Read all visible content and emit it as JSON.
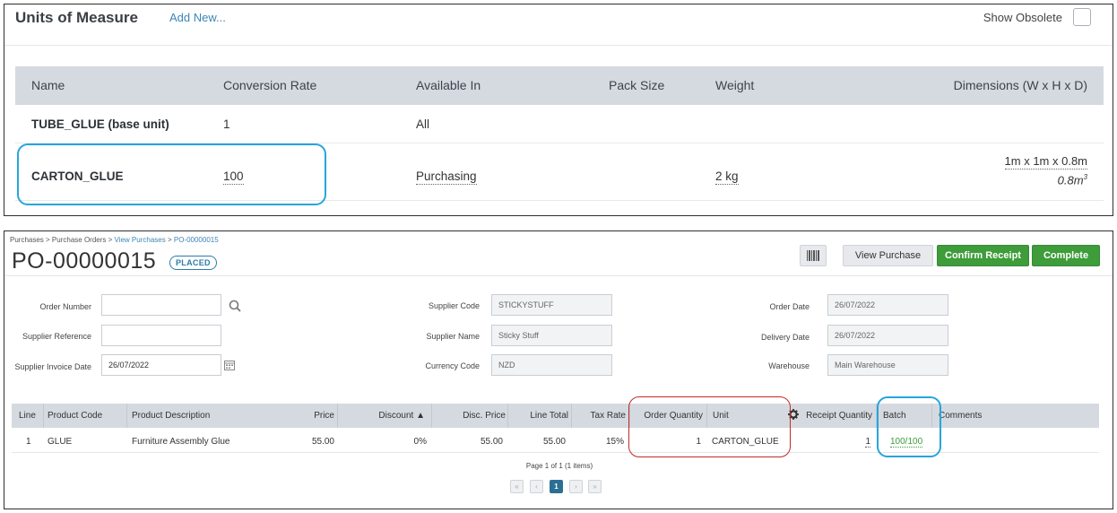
{
  "uom": {
    "title": "Units of Measure",
    "add_new": "Add New...",
    "show_obsolete": "Show Obsolete",
    "columns": [
      "Name",
      "Conversion Rate",
      "Available In",
      "Pack Size",
      "Weight",
      "Dimensions (W x H x D)"
    ],
    "rows": [
      {
        "name": "TUBE_GLUE (base unit)",
        "rate": "1",
        "available": "All",
        "pack": "",
        "weight": "",
        "dims": "",
        "volume": ""
      },
      {
        "name": "CARTON_GLUE",
        "rate": "100",
        "available": "Purchasing",
        "pack": "",
        "weight": "2 kg",
        "dims": "1m x 1m x 0.8m",
        "volume": "0.8m",
        "volume_sup": "3"
      }
    ]
  },
  "po": {
    "breadcrumb": [
      "Purchases",
      "Purchase Orders",
      "View Purchases",
      "PO-00000015"
    ],
    "breadcrumb_sep": " > ",
    "title": "PO-00000015",
    "status": "PLACED",
    "buttons": {
      "view": "View Purchase",
      "confirm": "Confirm Receipt",
      "complete": "Complete"
    },
    "fields": {
      "order_number": {
        "label": "Order Number",
        "value": ""
      },
      "supplier_reference": {
        "label": "Supplier Reference",
        "value": ""
      },
      "supplier_invoice_date": {
        "label": "Supplier Invoice Date",
        "value": "26/07/2022"
      },
      "supplier_code": {
        "label": "Supplier Code",
        "value": "STICKYSTUFF"
      },
      "supplier_name": {
        "label": "Supplier Name",
        "value": "Sticky Stuff"
      },
      "currency_code": {
        "label": "Currency Code",
        "value": "NZD"
      },
      "order_date": {
        "label": "Order Date",
        "value": "26/07/2022"
      },
      "delivery_date": {
        "label": "Delivery Date",
        "value": "26/07/2022"
      },
      "warehouse": {
        "label": "Warehouse",
        "value": "Main Warehouse"
      }
    },
    "grid": {
      "columns": [
        "Line",
        "Product Code",
        "Product Description",
        "Price",
        "Discount ▲",
        "Disc. Price",
        "Line Total",
        "Tax Rate",
        "Order Quantity",
        "Unit",
        "Receipt Quantity",
        "Batch",
        "Comments"
      ],
      "row": {
        "line": "1",
        "code": "GLUE",
        "desc": "Furniture Assembly Glue",
        "price": "55.00",
        "discount": "0%",
        "disc_price": "55.00",
        "line_total": "55.00",
        "tax": "15%",
        "order_qty": "1",
        "unit": "CARTON_GLUE",
        "receipt_qty": "1",
        "batch": "100/100",
        "comments": ""
      }
    },
    "pager": {
      "text": "Page 1 of 1 (1 items)",
      "current": "1"
    }
  },
  "colors": {
    "accent_blue": "#27a5dc",
    "highlight_red": "#c62828",
    "green": "#3e9c3a",
    "header_grey": "#d5dae0"
  }
}
